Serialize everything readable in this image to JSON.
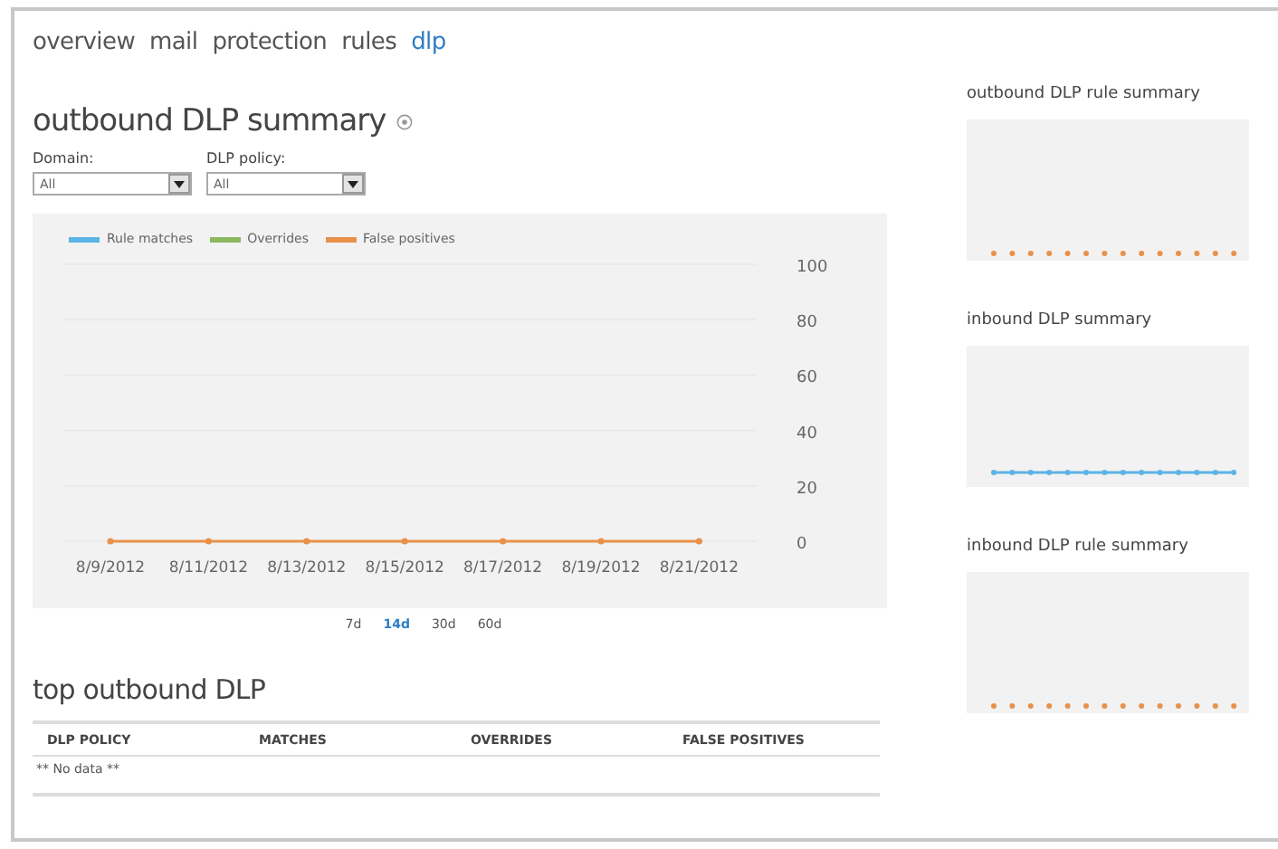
{
  "nav": [
    {
      "label": "overview",
      "selected": false
    },
    {
      "label": "mail",
      "selected": false
    },
    {
      "label": "protection",
      "selected": false
    },
    {
      "label": "rules",
      "selected": false
    },
    {
      "label": "dlp",
      "selected": true
    }
  ],
  "summary": {
    "title": "outbound DLP summary",
    "filters": [
      {
        "label": "Domain:",
        "value": "All"
      },
      {
        "label": "DLP policy:",
        "value": "All"
      }
    ],
    "chart_data": {
      "type": "line",
      "categories": [
        "8/9/2012",
        "8/11/2012",
        "8/13/2012",
        "8/15/2012",
        "8/17/2012",
        "8/19/2012",
        "8/21/2012"
      ],
      "ylim": [
        0,
        100
      ],
      "yticks": [
        0,
        20,
        40,
        60,
        80,
        100
      ],
      "grid": true,
      "series": [
        {
          "name": "Rule matches",
          "color": "#5bb4e5",
          "values": [
            null,
            null,
            null,
            null,
            null,
            null,
            null
          ]
        },
        {
          "name": "Overrides",
          "color": "#8cb860",
          "values": [
            null,
            null,
            null,
            null,
            null,
            null,
            null
          ]
        },
        {
          "name": "False positives",
          "color": "#e8914a",
          "marker": true,
          "values": [
            0,
            0,
            0,
            0,
            0,
            0,
            0
          ]
        }
      ]
    },
    "ranges": [
      {
        "label": "7d",
        "selected": false
      },
      {
        "label": "14d",
        "selected": true
      },
      {
        "label": "30d",
        "selected": false
      },
      {
        "label": "60d",
        "selected": false
      }
    ]
  },
  "top": {
    "title": "top outbound DLP",
    "columns": [
      "DLP POLICY",
      "MATCHES",
      "OVERRIDES",
      "FALSE POSITIVES"
    ],
    "empty": "** No data **"
  },
  "side_charts": [
    {
      "title": "outbound DLP rule summary",
      "kind": "dots"
    },
    {
      "title": "inbound DLP summary",
      "kind": "line"
    },
    {
      "title": "inbound DLP rule summary",
      "kind": "dots"
    }
  ]
}
